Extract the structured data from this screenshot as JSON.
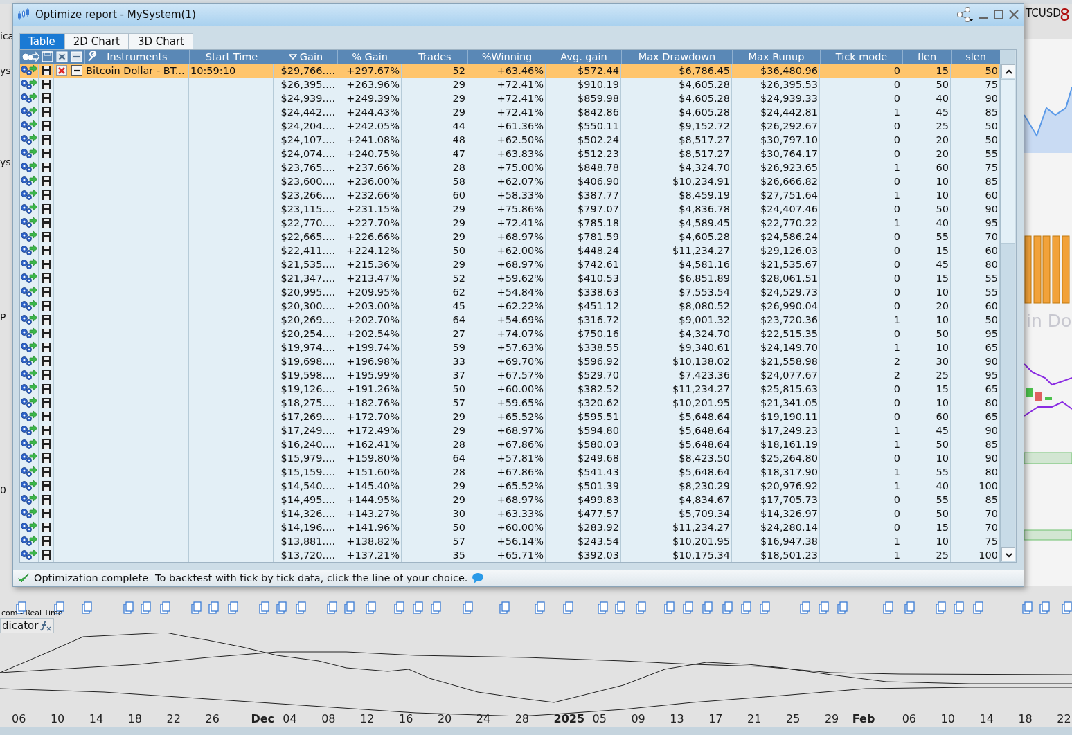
{
  "background": {
    "edge_texts": [
      "ica",
      "ys",
      "ys",
      "P",
      "0"
    ],
    "symbol": "TCUSD",
    "price_digit": "8",
    "panel_title": "in Do",
    "feed_label": "com - Real Time",
    "indicator_label": "dicator",
    "axis_labels": [
      {
        "text": "06",
        "kind": "day"
      },
      {
        "text": "10",
        "kind": "day"
      },
      {
        "text": "14",
        "kind": "day"
      },
      {
        "text": "18",
        "kind": "day"
      },
      {
        "text": "22",
        "kind": "day"
      },
      {
        "text": "26",
        "kind": "day"
      },
      {
        "text": "Dec",
        "kind": "month"
      },
      {
        "text": "04",
        "kind": "day"
      },
      {
        "text": "08",
        "kind": "day"
      },
      {
        "text": "12",
        "kind": "day"
      },
      {
        "text": "16",
        "kind": "day"
      },
      {
        "text": "20",
        "kind": "day"
      },
      {
        "text": "24",
        "kind": "day"
      },
      {
        "text": "28",
        "kind": "day"
      },
      {
        "text": "2025",
        "kind": "year"
      },
      {
        "text": "05",
        "kind": "day"
      },
      {
        "text": "09",
        "kind": "day"
      },
      {
        "text": "13",
        "kind": "day"
      },
      {
        "text": "17",
        "kind": "day"
      },
      {
        "text": "21",
        "kind": "day"
      },
      {
        "text": "25",
        "kind": "day"
      },
      {
        "text": "29",
        "kind": "day"
      },
      {
        "text": "Feb",
        "kind": "month"
      },
      {
        "text": "06",
        "kind": "day"
      },
      {
        "text": "10",
        "kind": "day"
      },
      {
        "text": "14",
        "kind": "day"
      },
      {
        "text": "18",
        "kind": "day"
      },
      {
        "text": "22",
        "kind": "day"
      }
    ]
  },
  "window": {
    "title": "Optimize report - MySystem(1)"
  },
  "tabs": [
    {
      "label": "Table",
      "selected": true
    },
    {
      "label": "2D Chart",
      "selected": false
    },
    {
      "label": "3D Chart",
      "selected": false
    }
  ],
  "table": {
    "columns": [
      {
        "label": "Instruments",
        "sorted": false
      },
      {
        "label": "Start Time",
        "sorted": false
      },
      {
        "label": "Gain",
        "sorted": true
      },
      {
        "label": "% Gain",
        "sorted": false
      },
      {
        "label": "Trades",
        "sorted": false
      },
      {
        "label": "%Winning",
        "sorted": false
      },
      {
        "label": "Avg. gain",
        "sorted": false
      },
      {
        "label": "Max Drawdown",
        "sorted": false
      },
      {
        "label": "Max Runup",
        "sorted": false
      },
      {
        "label": "Tick mode",
        "sorted": false
      },
      {
        "label": "flen",
        "sorted": false
      },
      {
        "label": "slen",
        "sorted": false
      }
    ],
    "rows": [
      {
        "selected": true,
        "expandable": true,
        "cells": [
          "Bitcoin Dollar - BT...",
          "10:59:10",
          "$29,766....",
          "+297.67%",
          "52",
          "+63.46%",
          "$572.44",
          "$6,786.45",
          "$36,480.96",
          "0",
          "15",
          "50"
        ]
      },
      {
        "selected": false,
        "expandable": false,
        "cells": [
          "",
          "",
          "$26,395....",
          "+263.96%",
          "29",
          "+72.41%",
          "$910.19",
          "$4,605.28",
          "$26,395.53",
          "0",
          "50",
          "75"
        ]
      },
      {
        "selected": false,
        "expandable": false,
        "cells": [
          "",
          "",
          "$24,939....",
          "+249.39%",
          "29",
          "+72.41%",
          "$859.98",
          "$4,605.28",
          "$24,939.33",
          "0",
          "40",
          "90"
        ]
      },
      {
        "selected": false,
        "expandable": false,
        "cells": [
          "",
          "",
          "$24,442....",
          "+244.43%",
          "29",
          "+72.41%",
          "$842.86",
          "$4,605.28",
          "$24,442.81",
          "1",
          "45",
          "85"
        ]
      },
      {
        "selected": false,
        "expandable": false,
        "cells": [
          "",
          "",
          "$24,204....",
          "+242.05%",
          "44",
          "+61.36%",
          "$550.11",
          "$9,152.72",
          "$26,292.67",
          "0",
          "25",
          "50"
        ]
      },
      {
        "selected": false,
        "expandable": false,
        "cells": [
          "",
          "",
          "$24,107....",
          "+241.08%",
          "48",
          "+62.50%",
          "$502.24",
          "$8,517.27",
          "$30,797.10",
          "0",
          "20",
          "50"
        ]
      },
      {
        "selected": false,
        "expandable": false,
        "cells": [
          "",
          "",
          "$24,074....",
          "+240.75%",
          "47",
          "+63.83%",
          "$512.23",
          "$8,517.27",
          "$30,764.17",
          "0",
          "20",
          "55"
        ]
      },
      {
        "selected": false,
        "expandable": false,
        "cells": [
          "",
          "",
          "$23,765....",
          "+237.66%",
          "28",
          "+75.00%",
          "$848.78",
          "$4,324.70",
          "$26,923.65",
          "1",
          "60",
          "75"
        ]
      },
      {
        "selected": false,
        "expandable": false,
        "cells": [
          "",
          "",
          "$23,600....",
          "+236.00%",
          "58",
          "+62.07%",
          "$406.90",
          "$10,234.91",
          "$26,666.82",
          "0",
          "10",
          "85"
        ]
      },
      {
        "selected": false,
        "expandable": false,
        "cells": [
          "",
          "",
          "$23,266....",
          "+232.66%",
          "60",
          "+58.33%",
          "$387.77",
          "$8,459.19",
          "$27,751.64",
          "1",
          "10",
          "60"
        ]
      },
      {
        "selected": false,
        "expandable": false,
        "cells": [
          "",
          "",
          "$23,115....",
          "+231.15%",
          "29",
          "+75.86%",
          "$797.07",
          "$4,836.78",
          "$24,407.46",
          "0",
          "50",
          "90"
        ]
      },
      {
        "selected": false,
        "expandable": false,
        "cells": [
          "",
          "",
          "$22,770....",
          "+227.70%",
          "29",
          "+72.41%",
          "$785.18",
          "$4,589.45",
          "$22,770.22",
          "1",
          "40",
          "95"
        ]
      },
      {
        "selected": false,
        "expandable": false,
        "cells": [
          "",
          "",
          "$22,665....",
          "+226.66%",
          "29",
          "+68.97%",
          "$781.59",
          "$4,605.28",
          "$24,586.24",
          "0",
          "55",
          "70"
        ]
      },
      {
        "selected": false,
        "expandable": false,
        "cells": [
          "",
          "",
          "$22,411....",
          "+224.12%",
          "50",
          "+62.00%",
          "$448.24",
          "$11,234.27",
          "$29,126.03",
          "0",
          "15",
          "60"
        ]
      },
      {
        "selected": false,
        "expandable": false,
        "cells": [
          "",
          "",
          "$21,535....",
          "+215.36%",
          "29",
          "+68.97%",
          "$742.61",
          "$4,581.16",
          "$21,535.67",
          "0",
          "45",
          "80"
        ]
      },
      {
        "selected": false,
        "expandable": false,
        "cells": [
          "",
          "",
          "$21,347....",
          "+213.47%",
          "52",
          "+59.62%",
          "$410.53",
          "$6,851.89",
          "$28,061.51",
          "0",
          "15",
          "55"
        ]
      },
      {
        "selected": false,
        "expandable": false,
        "cells": [
          "",
          "",
          "$20,995....",
          "+209.95%",
          "62",
          "+54.84%",
          "$338.63",
          "$7,553.54",
          "$24,529.73",
          "0",
          "10",
          "55"
        ]
      },
      {
        "selected": false,
        "expandable": false,
        "cells": [
          "",
          "",
          "$20,300....",
          "+203.00%",
          "45",
          "+62.22%",
          "$451.12",
          "$8,080.52",
          "$26,990.04",
          "0",
          "20",
          "60"
        ]
      },
      {
        "selected": false,
        "expandable": false,
        "cells": [
          "",
          "",
          "$20,269....",
          "+202.70%",
          "64",
          "+54.69%",
          "$316.72",
          "$9,001.32",
          "$23,720.36",
          "1",
          "10",
          "50"
        ]
      },
      {
        "selected": false,
        "expandable": false,
        "cells": [
          "",
          "",
          "$20,254....",
          "+202.54%",
          "27",
          "+74.07%",
          "$750.16",
          "$4,324.70",
          "$22,515.35",
          "0",
          "50",
          "95"
        ]
      },
      {
        "selected": false,
        "expandable": false,
        "cells": [
          "",
          "",
          "$19,974....",
          "+199.74%",
          "59",
          "+57.63%",
          "$338.55",
          "$9,340.61",
          "$24,149.70",
          "1",
          "10",
          "65"
        ]
      },
      {
        "selected": false,
        "expandable": false,
        "cells": [
          "",
          "",
          "$19,698....",
          "+196.98%",
          "33",
          "+69.70%",
          "$596.92",
          "$10,138.02",
          "$21,558.98",
          "2",
          "30",
          "90"
        ]
      },
      {
        "selected": false,
        "expandable": false,
        "cells": [
          "",
          "",
          "$19,598....",
          "+195.99%",
          "37",
          "+67.57%",
          "$529.70",
          "$7,423.36",
          "$24,077.67",
          "2",
          "25",
          "95"
        ]
      },
      {
        "selected": false,
        "expandable": false,
        "cells": [
          "",
          "",
          "$19,126....",
          "+191.26%",
          "50",
          "+60.00%",
          "$382.52",
          "$11,234.27",
          "$25,815.63",
          "0",
          "15",
          "65"
        ]
      },
      {
        "selected": false,
        "expandable": false,
        "cells": [
          "",
          "",
          "$18,275....",
          "+182.76%",
          "57",
          "+59.65%",
          "$320.62",
          "$10,201.95",
          "$21,341.05",
          "0",
          "10",
          "80"
        ]
      },
      {
        "selected": false,
        "expandable": false,
        "cells": [
          "",
          "",
          "$17,269....",
          "+172.70%",
          "29",
          "+65.52%",
          "$595.51",
          "$5,648.64",
          "$19,190.11",
          "0",
          "60",
          "65"
        ]
      },
      {
        "selected": false,
        "expandable": false,
        "cells": [
          "",
          "",
          "$17,249....",
          "+172.49%",
          "29",
          "+68.97%",
          "$594.80",
          "$5,648.64",
          "$17,249.23",
          "1",
          "45",
          "90"
        ]
      },
      {
        "selected": false,
        "expandable": false,
        "cells": [
          "",
          "",
          "$16,240....",
          "+162.41%",
          "28",
          "+67.86%",
          "$580.03",
          "$5,648.64",
          "$18,161.19",
          "1",
          "50",
          "85"
        ]
      },
      {
        "selected": false,
        "expandable": false,
        "cells": [
          "",
          "",
          "$15,979....",
          "+159.80%",
          "64",
          "+57.81%",
          "$249.68",
          "$8,423.50",
          "$25,264.80",
          "0",
          "10",
          "90"
        ]
      },
      {
        "selected": false,
        "expandable": false,
        "cells": [
          "",
          "",
          "$15,159....",
          "+151.60%",
          "28",
          "+67.86%",
          "$541.43",
          "$5,648.64",
          "$18,317.90",
          "1",
          "55",
          "80"
        ]
      },
      {
        "selected": false,
        "expandable": false,
        "cells": [
          "",
          "",
          "$14,540....",
          "+145.40%",
          "29",
          "+65.52%",
          "$501.39",
          "$8,230.29",
          "$20,976.92",
          "1",
          "40",
          "100"
        ]
      },
      {
        "selected": false,
        "expandable": false,
        "cells": [
          "",
          "",
          "$14,495....",
          "+144.95%",
          "29",
          "+68.97%",
          "$499.83",
          "$4,834.67",
          "$17,705.73",
          "0",
          "55",
          "85"
        ]
      },
      {
        "selected": false,
        "expandable": false,
        "cells": [
          "",
          "",
          "$14,326....",
          "+143.27%",
          "30",
          "+63.33%",
          "$477.57",
          "$5,709.34",
          "$14,326.97",
          "0",
          "50",
          "70"
        ]
      },
      {
        "selected": false,
        "expandable": false,
        "cells": [
          "",
          "",
          "$14,196....",
          "+141.96%",
          "50",
          "+60.00%",
          "$283.92",
          "$11,234.27",
          "$24,280.14",
          "0",
          "15",
          "70"
        ]
      },
      {
        "selected": false,
        "expandable": false,
        "cells": [
          "",
          "",
          "$13,881....",
          "+138.82%",
          "57",
          "+56.14%",
          "$243.54",
          "$10,201.95",
          "$16,947.38",
          "1",
          "10",
          "75"
        ]
      },
      {
        "selected": false,
        "expandable": false,
        "cells": [
          "",
          "",
          "$13,720....",
          "+137.21%",
          "35",
          "+65.71%",
          "$392.03",
          "$10,175.34",
          "$18,501.23",
          "1",
          "25",
          "100"
        ]
      }
    ]
  },
  "status_bar": {
    "status": "Optimization complete",
    "hint": "To backtest with tick by tick data, click the line of your choice."
  }
}
